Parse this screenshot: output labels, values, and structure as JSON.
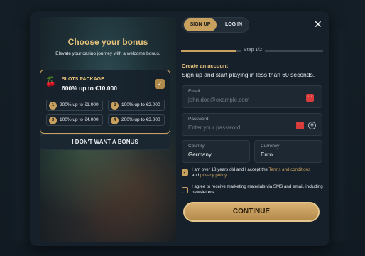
{
  "bonus": {
    "title": "Choose your bonus",
    "subtitle": "Elevate your casino journey with a welcome bonus.",
    "package": {
      "name": "SLOTS PACKAGE",
      "amount": "600% up to €10.000",
      "tiers": [
        {
          "n": "1",
          "text": "200% up to €1.000"
        },
        {
          "n": "2",
          "text": "100% up to €2.000"
        },
        {
          "n": "3",
          "text": "100% up to €4.000"
        },
        {
          "n": "4",
          "text": "200% up to €3.000"
        }
      ]
    },
    "no_bonus_label": "I DON'T WANT A BONUS"
  },
  "tabs": {
    "sign_up": "SIGN UP",
    "log_in": "LOG IN"
  },
  "step": "Step 1/2",
  "heading": "Create an account",
  "subheading": "Sign up and start playing in less than 60 seconds.",
  "email": {
    "label": "Email",
    "placeholder": "john.doe@example.com"
  },
  "password": {
    "label": "Password",
    "placeholder": "Enter your password"
  },
  "country": {
    "label": "Country",
    "value": "Germany"
  },
  "currency": {
    "label": "Currency",
    "value": "Euro"
  },
  "consent_age": {
    "pre": "I am over 18 years old and I accept the ",
    "terms_link": "Terms and conditions",
    "mid": "and ",
    "privacy_link": "privacy policy"
  },
  "consent_marketing": "I agree to receive marketing materials via SMS and email, including newsletters",
  "continue_label": "CONTINUE"
}
